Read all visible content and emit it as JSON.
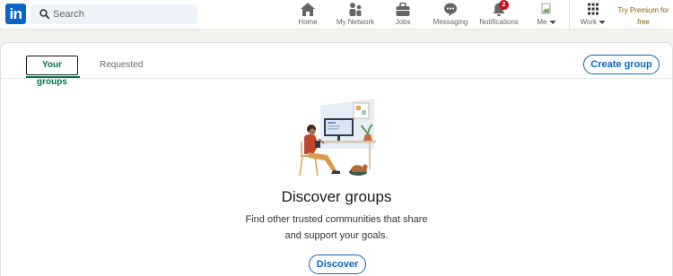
{
  "brand": {
    "logo_text": "in",
    "color": "#0a66c2"
  },
  "search": {
    "placeholder": "Search",
    "icon": "search-icon"
  },
  "nav": {
    "items": [
      {
        "label": "Home",
        "icon": "home-icon"
      },
      {
        "label": "My Network",
        "icon": "network-icon"
      },
      {
        "label": "Jobs",
        "icon": "briefcase-icon"
      },
      {
        "label": "Messaging",
        "icon": "message-icon"
      },
      {
        "label": "Notifications",
        "icon": "bell-icon",
        "badge": "2"
      },
      {
        "label": "Me",
        "icon": "avatar"
      },
      {
        "label": "Work",
        "icon": "grid-icon"
      }
    ],
    "premium_line1": "Try Premium for",
    "premium_line2": "free"
  },
  "tabs": {
    "active": "Your groups",
    "other": "Requested"
  },
  "create_group_label": "Create group",
  "empty_state": {
    "title": "Discover groups",
    "line1": "Find other trusted communities that share",
    "line2": "and support your goals.",
    "button": "Discover"
  },
  "colors": {
    "accent_green": "#01754f",
    "link_blue": "#0a66c2",
    "badge_red": "#cc1016",
    "premium_gold": "#915907"
  }
}
